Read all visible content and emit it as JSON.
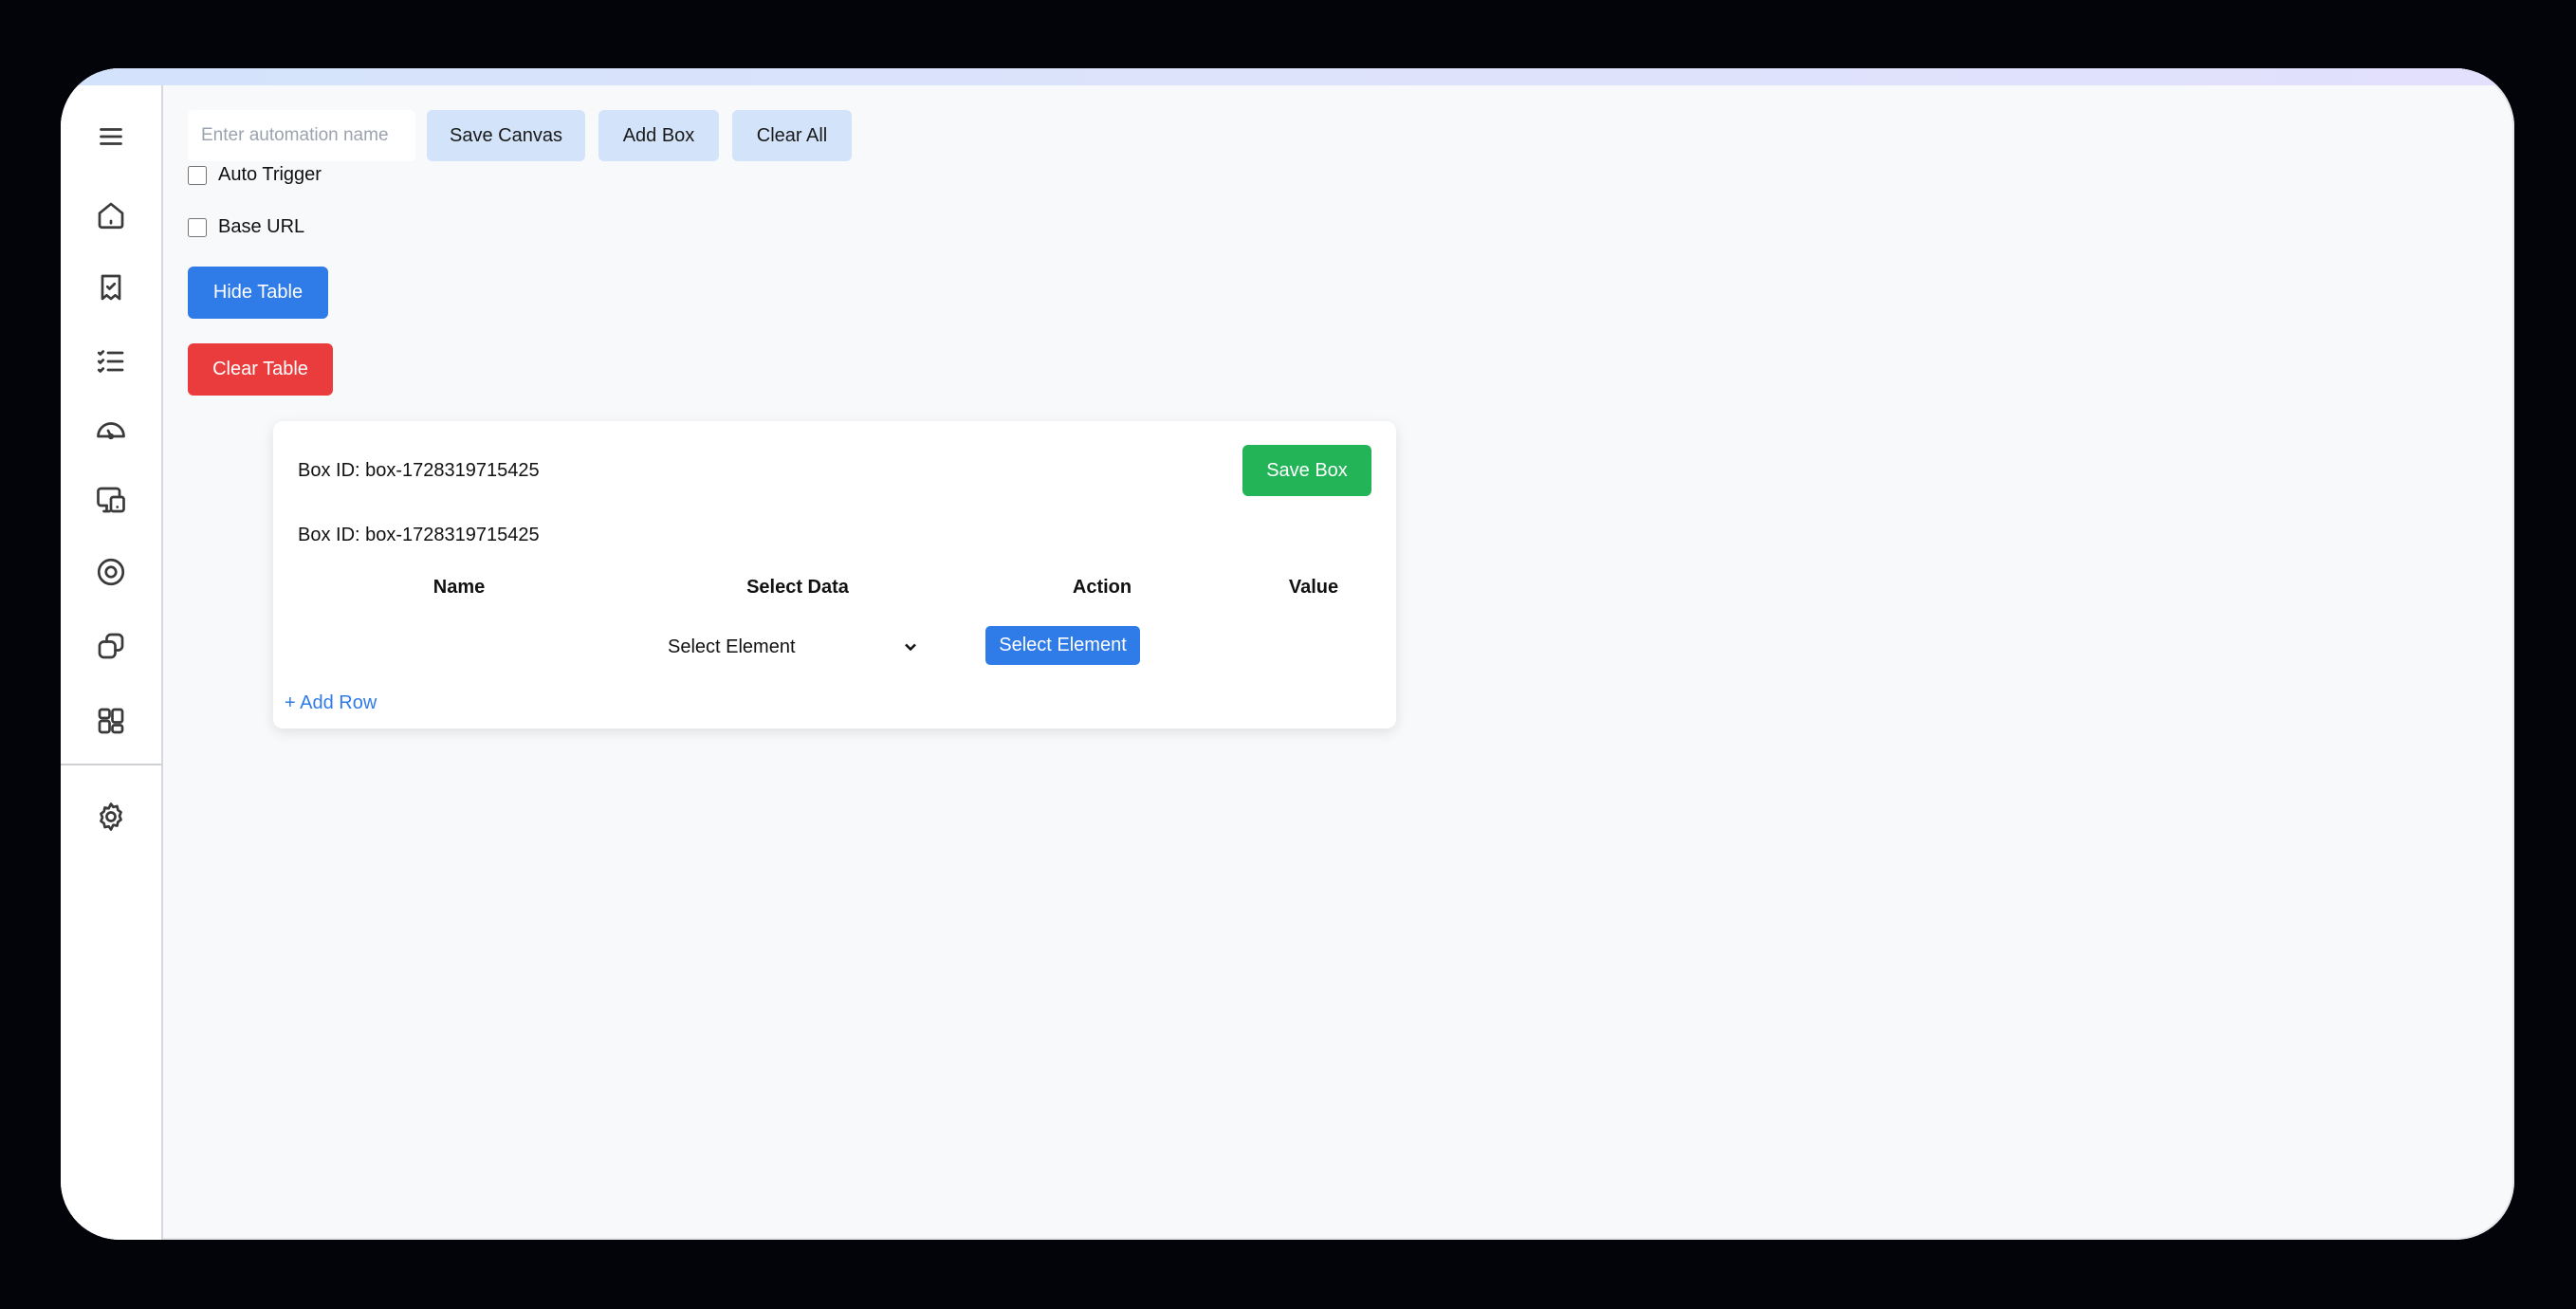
{
  "sidebar": {
    "items": [
      {
        "name": "menu-icon"
      },
      {
        "name": "home-icon"
      },
      {
        "name": "bookmark-check-icon"
      },
      {
        "name": "checklist-icon"
      },
      {
        "name": "gauge-icon"
      },
      {
        "name": "devices-icon"
      },
      {
        "name": "target-icon"
      },
      {
        "name": "copy-icon"
      },
      {
        "name": "grid-icon"
      }
    ],
    "settings": {
      "name": "gear-icon"
    }
  },
  "toolbar": {
    "name_input_placeholder": "Enter automation name",
    "name_input_value": "",
    "save_canvas_label": "Save Canvas",
    "add_box_label": "Add Box",
    "clear_all_label": "Clear All"
  },
  "options": {
    "auto_trigger_label": "Auto Trigger",
    "auto_trigger_checked": false,
    "base_url_label": "Base URL",
    "base_url_checked": false
  },
  "actions": {
    "hide_table_label": "Hide Table",
    "clear_table_label": "Clear Table"
  },
  "box": {
    "header_id": "Box ID: box-1728319715425",
    "save_box_label": "Save Box",
    "table_id": "Box ID: box-1728319715425",
    "columns": [
      "Name",
      "Select Data",
      "Action",
      "Value"
    ],
    "rows": [
      {
        "name": "",
        "select_data": "Select Element",
        "action_label": "Select Element",
        "value": ""
      }
    ],
    "add_row_label": "+ Add Row"
  },
  "colors": {
    "primary": "#2f7be8",
    "danger": "#ea3c3c",
    "success": "#22b457",
    "toolbar_button": "#d3e3fa"
  }
}
